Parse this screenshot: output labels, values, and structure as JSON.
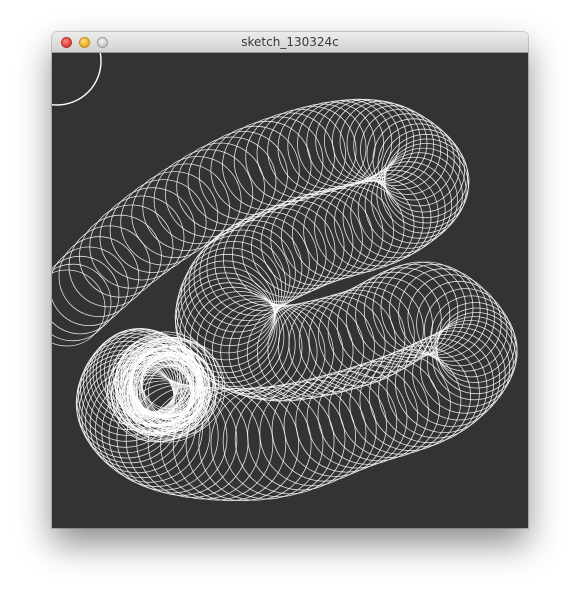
{
  "window": {
    "title": "sketch_130324c"
  },
  "controls": {
    "close": {
      "icon": "close-dot-icon",
      "color": "#e0443e"
    },
    "minimize": {
      "icon": "minimize-dot-icon",
      "color": "#f0b22b"
    },
    "zoom": {
      "icon": "zoom-dot-icon",
      "color": "#cfcfcf"
    }
  },
  "canvas": {
    "background": "#333333",
    "stroke": "#ffffff"
  }
}
